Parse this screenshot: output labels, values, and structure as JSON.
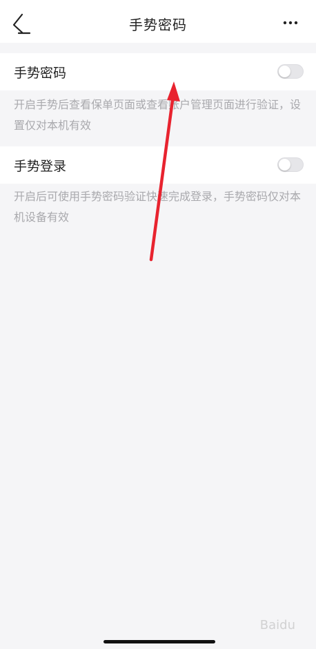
{
  "nav": {
    "title": "手势密码",
    "back_icon": "chevron-left-icon",
    "more_icon": "more-horizontal-icon"
  },
  "gesture_password": {
    "label": "手势密码",
    "enabled": false,
    "hint": "开启手势后查看保单页面或查看账户管理页面进行验证，设置仅对本机有效"
  },
  "gesture_login": {
    "label": "手势登录",
    "enabled": false,
    "hint": "开启后可使用手势密码验证快速完成登录，手势密码仅对本机设备有效"
  },
  "watermark": {
    "brand": "Baidu"
  },
  "colors": {
    "background": "#f5f5f7",
    "toggle_off": "#e6e6e9",
    "annotation_arrow": "#e8232f"
  }
}
